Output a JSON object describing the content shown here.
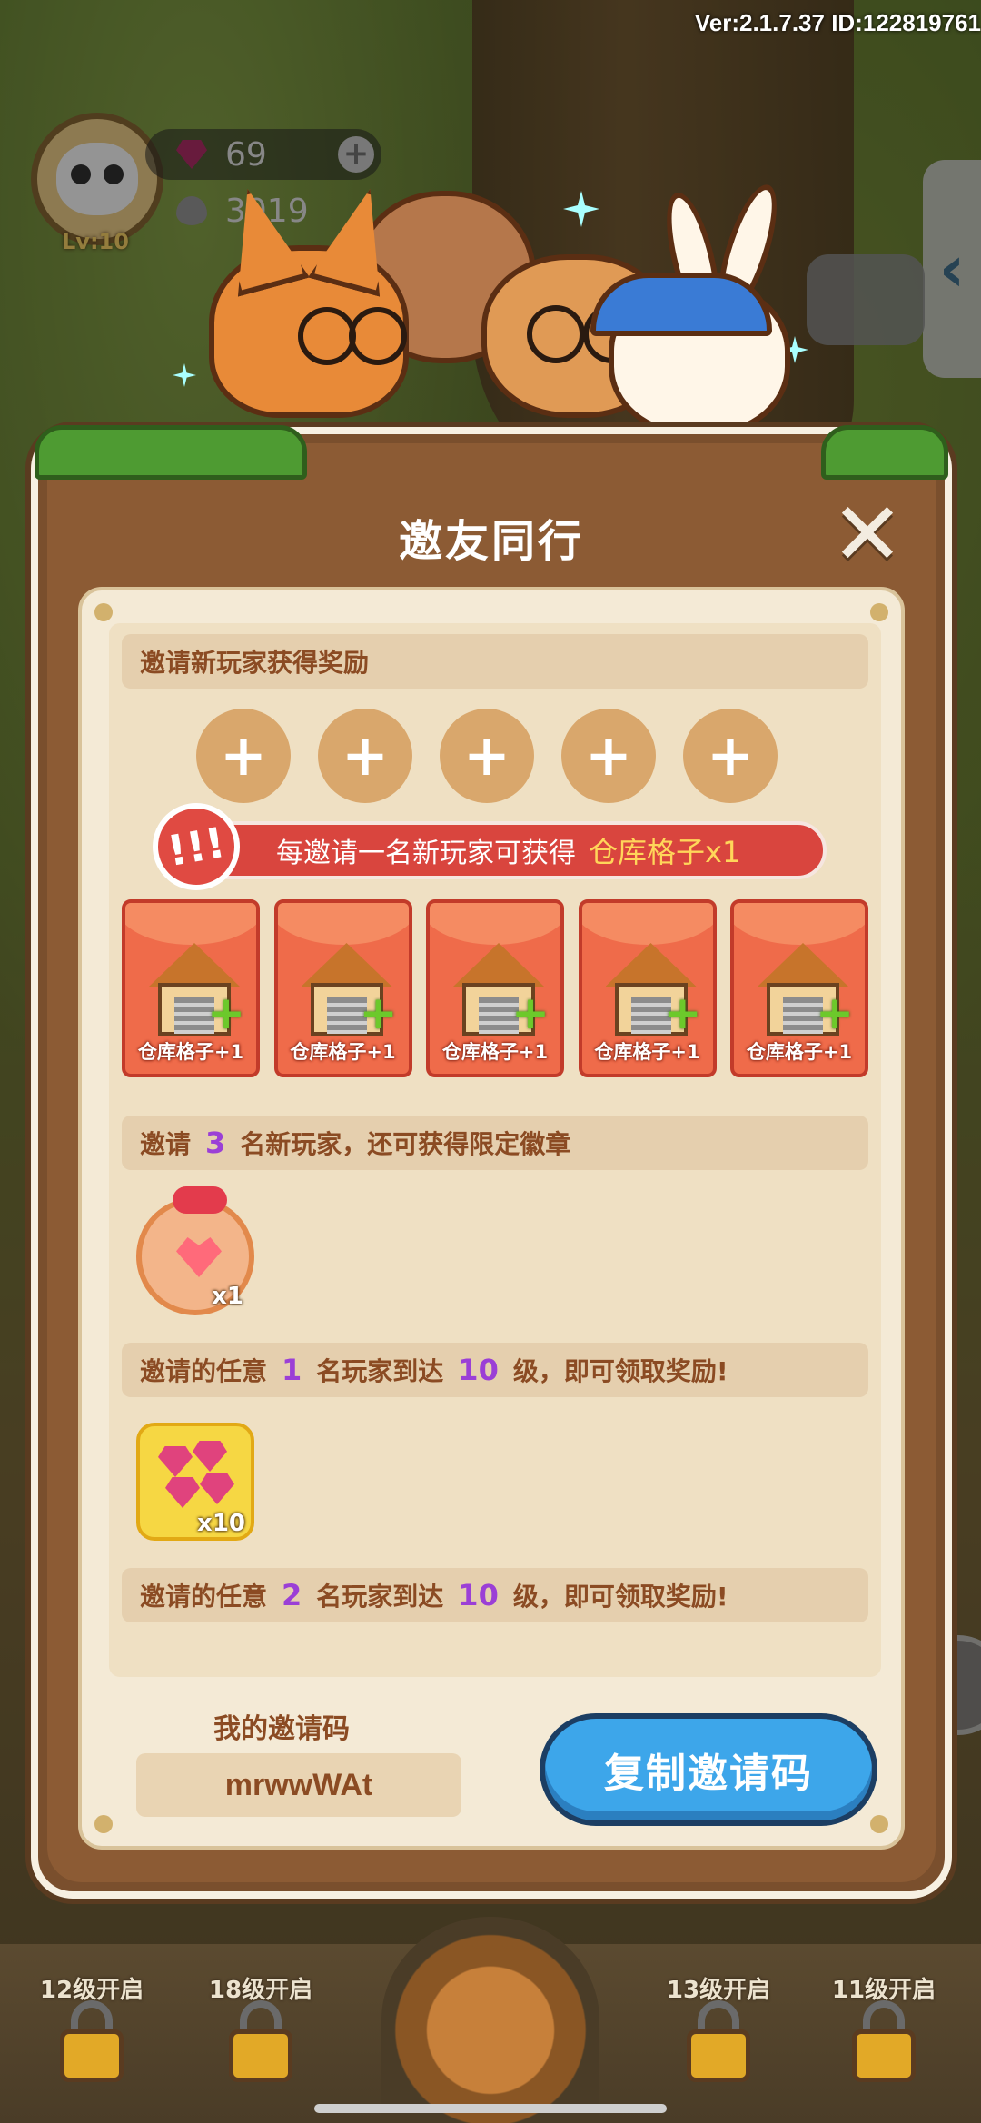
{
  "hud": {
    "version": "Ver:2.1.7.37 ID:122819761",
    "level": "Lv:10",
    "gems": "69",
    "seeds": "3019"
  },
  "modal": {
    "title": "邀友同行",
    "section_invite": "邀请新玩家获得奖励",
    "slots_plus": [
      "+",
      "+",
      "+",
      "+",
      "+"
    ],
    "banner_text": "每邀请一名新玩家可获得",
    "banner_highlight": "仓库格子x1",
    "banner_icon": "!!!",
    "reward_cards": [
      {
        "label": "仓库格子+1"
      },
      {
        "label": "仓库格子+1"
      },
      {
        "label": "仓库格子+1"
      },
      {
        "label": "仓库格子+1"
      },
      {
        "label": "仓库格子+1"
      }
    ],
    "badge_row": {
      "pre": "邀请",
      "num": "3",
      "post": "名新玩家，还可获得限定徽章"
    },
    "badge_qty": "x1",
    "level_row_1": {
      "pre": "邀请的任意",
      "num1": "1",
      "mid": "名玩家到达",
      "num2": "10",
      "post": "级，即可领取奖励!"
    },
    "gem_qty": "x10",
    "level_row_2": {
      "pre": "邀请的任意",
      "num1": "2",
      "mid": "名玩家到达",
      "num2": "10",
      "post": "级，即可领取奖励!"
    },
    "code_label": "我的邀请码",
    "code_value": "mrwwWAt",
    "copy_button": "复制邀请码",
    "close": "✕"
  },
  "bottom": {
    "locks": [
      "12级开启",
      "18级开启",
      "13级开启",
      "11级开启"
    ]
  },
  "colors": {
    "accent_blue": "#3da6ea",
    "highlight_purple": "#9b3fd6",
    "card_red": "#ef6b4a"
  }
}
